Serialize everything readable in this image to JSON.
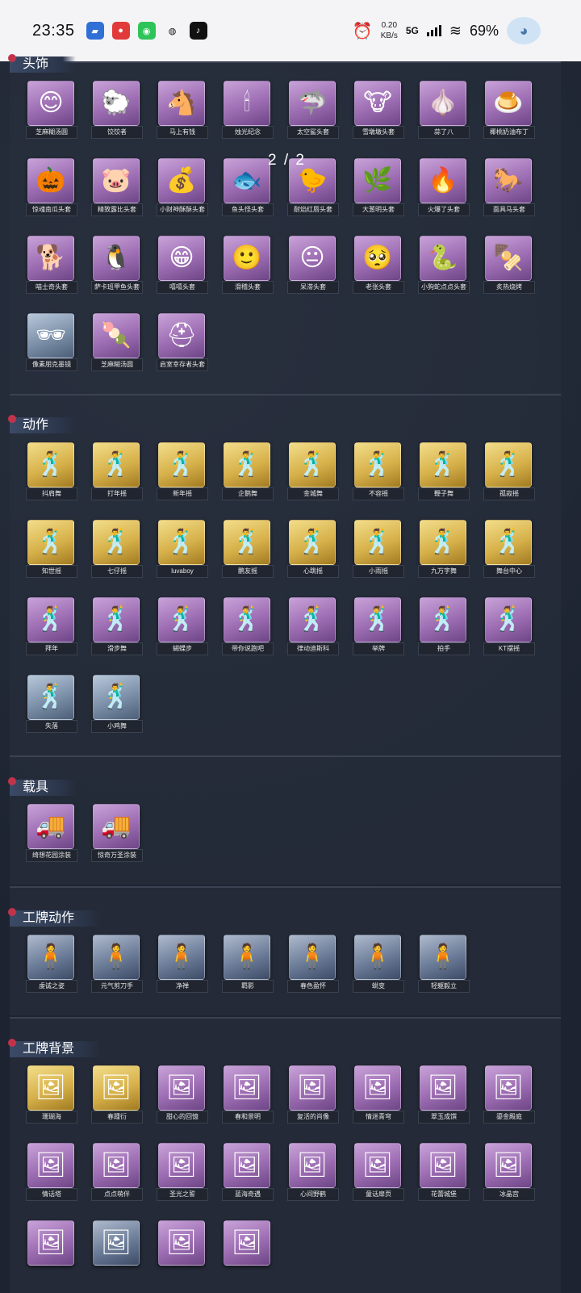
{
  "status_bar": {
    "time": "23:35",
    "net_speed_value": "0.20",
    "net_speed_unit": "KB/s",
    "network": "5G",
    "battery": "69%"
  },
  "pager": {
    "text": "2 / 2"
  },
  "sections": {
    "headwear": {
      "title": "头饰",
      "items": [
        "芝麻糊汤圆",
        "饺饺者",
        "马上有钱",
        "烛光纪念",
        "太空鲨头套",
        "雪墩墩头套",
        "蒜了八",
        "椰桃奶油布丁",
        "惊魂南瓜头套",
        "精致露比头套",
        "小财神酥酥头套",
        "鱼头怪头套",
        "耐焰红唇头套",
        "大葱明头套",
        "火爆了头套",
        "面具马头套",
        "喵士奇头套",
        "萨卡班甲鱼头套",
        "嘻嘻头套",
        "滑稽头套",
        "呆滞头套",
        "老张头套",
        "小狗蛇点点头套",
        "炙热烧烤",
        "像素朋克墨镜",
        "芝麻糊汤圆",
        "启室幸存者头套"
      ]
    },
    "actions": {
      "title": "动作",
      "items": [
        "抖肩舞",
        "打年摇",
        "新年摇",
        "企鹅舞",
        "金城舞",
        "不容摇",
        "鞭子舞",
        "孤寂摇",
        "知世摇",
        "七仔摇",
        "luvaboy",
        "鹏友摇",
        "心跳摇",
        "小雨摇",
        "九万字舞",
        "舞台中心",
        "拜年",
        "滑步舞",
        "蝴蝶步",
        "带你说跑吧",
        "律动迪斯科",
        "举牌",
        "拍手",
        "KT摆摇",
        "失落",
        "小鸡舞"
      ]
    },
    "vehicles": {
      "title": "载具",
      "items": [
        "绮想花园涂装",
        "惊奇万圣涂装"
      ]
    },
    "badge_actions": {
      "title": "工牌动作",
      "items": [
        "虔诚之姿",
        "元气剪刀手",
        "净禅",
        "羁影",
        "春色盈怀",
        "蜕变",
        "轻躯毅立"
      ]
    },
    "badge_backgrounds": {
      "title": "工牌背景",
      "items": [
        "珊瑚海",
        "春踵衍",
        "甜心的回憶",
        "春和景明",
        "复活的肖像",
        "情迷青穹",
        "翠玉成馔",
        "鎏金殿庭",
        "情话塔",
        "点点萌伴",
        "圣光之誓",
        "蓝海奇遇",
        "心间野鹤",
        "童话扉页",
        "花蕾城堡",
        "冰晶宫",
        "",
        "",
        "",
        ""
      ]
    }
  }
}
